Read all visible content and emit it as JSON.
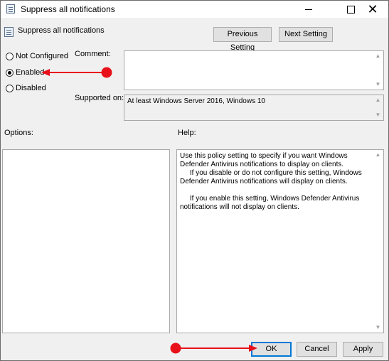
{
  "window": {
    "title": "Suppress all notifications",
    "controls": {
      "minimize_icon": "minimize-icon",
      "maximize_icon": "maximize-icon",
      "close_icon": "close-icon",
      "close_glyph": "✕"
    }
  },
  "header": {
    "policy_name": "Suppress all notifications",
    "previous_label": "Previous Setting",
    "next_label": "Next Setting"
  },
  "state": {
    "options": [
      {
        "label": "Not Configured",
        "checked": false
      },
      {
        "label": "Enabled",
        "checked": true
      },
      {
        "label": "Disabled",
        "checked": false
      }
    ]
  },
  "comment": {
    "label": "Comment:",
    "value": ""
  },
  "supported": {
    "label": "Supported on:",
    "value": "At least Windows Server 2016, Windows 10"
  },
  "options_panel": {
    "label": "Options:"
  },
  "help_panel": {
    "label": "Help:",
    "text": "Use this policy setting to specify if you want Windows Defender Antivirus notifications to display on clients.\n     If you disable or do not configure this setting, Windows Defender Antivirus notifications will display on clients.\n\n     If you enable this setting, Windows Defender Antivirus notifications will not display on clients."
  },
  "footer": {
    "ok_label": "OK",
    "cancel_label": "Cancel",
    "apply_label": "Apply"
  },
  "scroll": {
    "up_glyph": "▲",
    "down_glyph": "▼"
  },
  "colors": {
    "annotation": "#e8101a",
    "focus": "#0078d7"
  }
}
